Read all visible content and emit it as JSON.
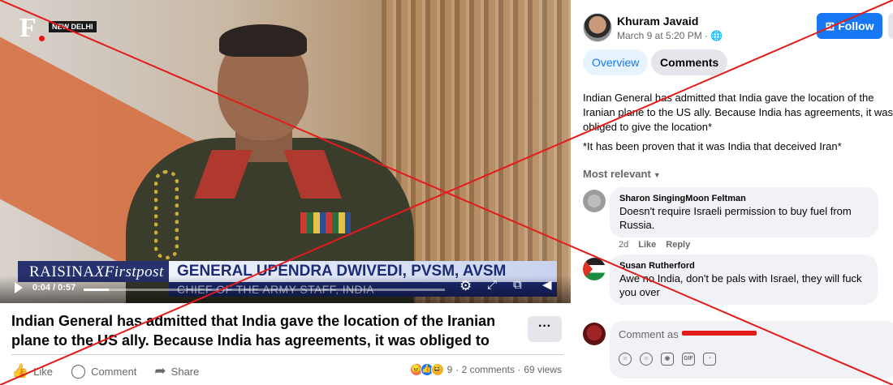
{
  "video": {
    "logo": "F",
    "location": "NEW DELHI",
    "lower_third": {
      "brand": "RAISINA",
      "brand_suffix": "XFirstpost",
      "name": "GENERAL UPENDRA DWIVEDI, PVSM, AVSM",
      "role": "CHIEF OF THE ARMY STAFF, INDIA"
    },
    "time": "0:04 / 0:57",
    "progress": 0.07
  },
  "post": {
    "title": "Indian General has admitted that India gave the location of the Iranian plane to the US ally. Because India has agreements, it was obliged to gi…",
    "more_label": "···",
    "actions": {
      "like": "Like",
      "comment": "Comment",
      "share": "Share"
    },
    "stats": {
      "reaction_count": "9",
      "comments": "· 2 comments ·",
      "views": "69 views"
    }
  },
  "author": {
    "name": "Khuram Javaid",
    "time": "March 9 at 5:20 PM · ",
    "follow_label": "Follow"
  },
  "tabs": {
    "overview": "Overview",
    "comments": "Comments"
  },
  "body": {
    "paragraph1": "Indian General has admitted that India gave the location of the Iranian plane to the US ally. Because India has agreements, it was obliged to give the location*",
    "paragraph2": "*It has been proven that it was India that deceived Iran*"
  },
  "comments": {
    "sort_label": "Most relevant",
    "items": [
      {
        "name": "Sharon SingingMoon Feltman",
        "text": "Doesn't require Israeli permission to buy fuel from Russia.",
        "age": "2d",
        "like": "Like",
        "reply": "Reply"
      },
      {
        "name": "Susan Rutherford",
        "text": "Awe no India, don't be pals with Israel, they will fuck you over"
      }
    ],
    "composer_placeholder": "Comment as"
  },
  "colors": {
    "accent": "#1877f2",
    "strike": "#e31b1b"
  }
}
